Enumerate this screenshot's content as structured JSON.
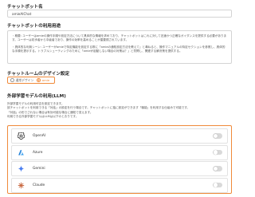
{
  "chatbot_name": {
    "heading": "チャットボット名",
    "value": "amieAIChat"
  },
  "chatbot_purpose": {
    "heading": "チャットボットの利用用途",
    "paragraph1": "・概要: ユーザーはamieの操作手順や設定方法について具体的な情報を求めており、チャットボットはこれに対して迅速かつ正確なガイダンスを提供する必要があります。ユーザーは初歩者から中級者であり、操作の効率を高めることが重要視されています。",
    "paragraph2": "・具体的な利用シーン: ユーザーがamieで特定機能を設定する際に「amieの通知設定方法を教えて」と尋ねると、操作マニュアルの特定セクションを参照し、具体的な手順を提示する。トラブルシューティングのために「amieが起動しない場合の対策は？」と質問し、関連する解決策を提供する。"
  },
  "design": {
    "heading": "チャットルームのデザイン設定",
    "option_standard": "通常デザイン",
    "option_amie": "amie"
  },
  "llm": {
    "heading": "外部学習モデルの利用(LLM)",
    "desc1": "外部学習モデルの利用可否を設定できます。",
    "desc2": "該チャットボットを利用できる「対話」の設定を行う場合です。チャットボットに独に設定ができます「機能」を利用する仕組みで可能です。",
    "desc3": "「対話」の形でされない場合は有効可能な場合に通知で変えます。",
    "desc4": "利用できる外部学習モデルはLLMは以下のとおりです。"
  },
  "models": [
    {
      "name": "OpenAI",
      "icon": "openai-icon",
      "enabled": false
    },
    {
      "name": "Azure",
      "icon": "azure-icon",
      "enabled": false
    },
    {
      "name": "Gemini",
      "icon": "gemini-icon",
      "enabled": false
    },
    {
      "name": "Claude",
      "icon": "claude-icon",
      "enabled": false
    }
  ],
  "colors": {
    "accent": "#f08a3a",
    "azure": "#1e7fd8",
    "gemini": "#4a7ef0"
  }
}
